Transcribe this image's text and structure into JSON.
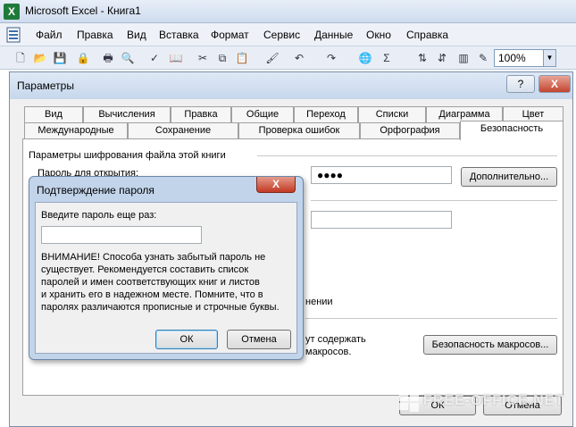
{
  "window": {
    "title": "Microsoft Excel - Книга1"
  },
  "menu": [
    "Файл",
    "Правка",
    "Вид",
    "Вставка",
    "Формат",
    "Сервис",
    "Данные",
    "Окно",
    "Справка"
  ],
  "toolbar": {
    "zoom": "100%"
  },
  "params_dialog": {
    "title": "Параметры",
    "help": "?",
    "close": "X",
    "tabs_row1": [
      "Вид",
      "Вычисления",
      "Правка",
      "Общие",
      "Переход",
      "Списки",
      "Диаграмма",
      "Цвет"
    ],
    "tabs_row2": [
      "Международные",
      "Сохранение",
      "Проверка ошибок",
      "Орфография",
      "Безопасность"
    ],
    "active_tab": "Безопасность",
    "section_label": "Параметры шифрования файла этой книги",
    "password_open_label": "Пароль для открытия:",
    "password_open_value": "●●●●",
    "advanced_button": "Дополнительно...",
    "partial_text_1": "нении",
    "partial_text_2a": "ут содержать",
    "partial_text_2b": "макросов.",
    "macro_security_button": "Безопасность макросов...",
    "ok_button": "ОК",
    "cancel_button": "Отмена"
  },
  "confirm_dialog": {
    "title": "Подтверждение пароля",
    "close": "X",
    "prompt": "Введите пароль еще раз:",
    "input_value": "",
    "warning_lines": [
      "ВНИМАНИЕ! Способа узнать забытый пароль не",
      "существует. Рекомендуется составить список",
      "паролей и имен соответствующих книг и листов",
      "и хранить его в надежном месте. Помните, что в",
      "паролях различаются прописные и строчные буквы."
    ],
    "ok_button": "ОК",
    "cancel_button": "Отмена"
  },
  "watermark": "FREE-OFFICE.NET"
}
